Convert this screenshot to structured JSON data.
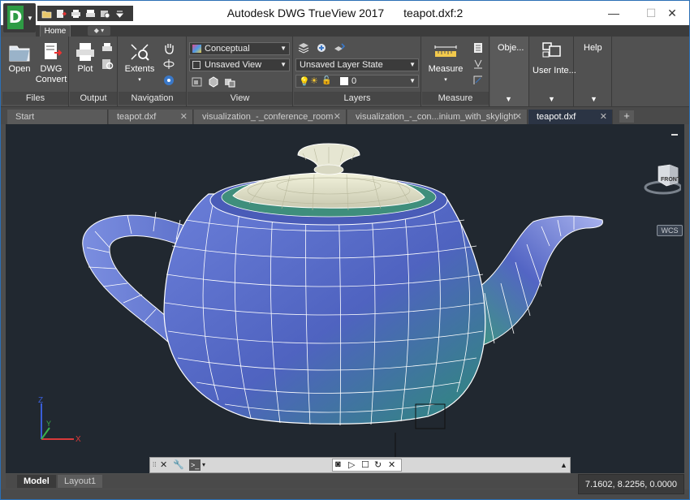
{
  "window": {
    "title": "Autodesk DWG TrueView 2017",
    "document": "teapot.dxf:2",
    "minimize": "—",
    "maximize": "☐",
    "close": "✕"
  },
  "app_logo": {
    "letter": "D",
    "arrow": "▼"
  },
  "quick_access": [
    {
      "icon": "open-folder-icon"
    },
    {
      "icon": "dwg-convert-icon"
    },
    {
      "icon": "print-icon"
    },
    {
      "icon": "batch-plot-icon"
    },
    {
      "icon": "publish-icon"
    },
    {
      "icon": "dropdown-icon"
    }
  ],
  "ribbon_tabs": {
    "home": "Home",
    "extra": "◆ ▾"
  },
  "ribbon": {
    "files": {
      "label": "Files",
      "open": "Open",
      "dwg_convert_1": "DWG",
      "dwg_convert_2": "Convert"
    },
    "output": {
      "label": "Output",
      "plot": "Plot"
    },
    "navigation": {
      "label": "Navigation",
      "extents": "Extents"
    },
    "view": {
      "label": "View",
      "visual_style": "Conceptual",
      "named_view": "Unsaved View"
    },
    "layers": {
      "label": "Layers",
      "layer_state": "Unsaved Layer State",
      "current_layer": "0"
    },
    "measure": {
      "label": "Measure",
      "measure": "Measure"
    },
    "objects": {
      "label": "Obje..."
    },
    "user_interface": {
      "label": "User Inte..."
    },
    "help": {
      "label": "Help"
    }
  },
  "doc_tabs": [
    {
      "label": "Start",
      "close": ""
    },
    {
      "label": "teapot.dxf",
      "close": "✕"
    },
    {
      "label": "visualization_-_conference_room",
      "close": "✕"
    },
    {
      "label": "visualization_-_con...inium_with_skylight",
      "close": "✕"
    },
    {
      "label": "teapot.dxf",
      "close": "✕"
    }
  ],
  "new_tab": "+",
  "viewcube": {
    "face": "FRONT",
    "ucs": "WCS"
  },
  "ucs_icon": {
    "x": "X",
    "y": "Y",
    "z": "Z"
  },
  "command_line": {
    "prompt_icon": ">_",
    "caret": "▾",
    "expand": "▲"
  },
  "layout_tabs": [
    {
      "label": "Model"
    },
    {
      "label": "Layout1"
    }
  ],
  "status": {
    "coordinates": "7.1602, 8.2256, 0.0000"
  },
  "colors": {
    "viewport_bg": "#212830",
    "teapot_body": "#5a6ec8",
    "teapot_lid": "#e8e8cf",
    "teapot_shade": "#2d8a78"
  }
}
